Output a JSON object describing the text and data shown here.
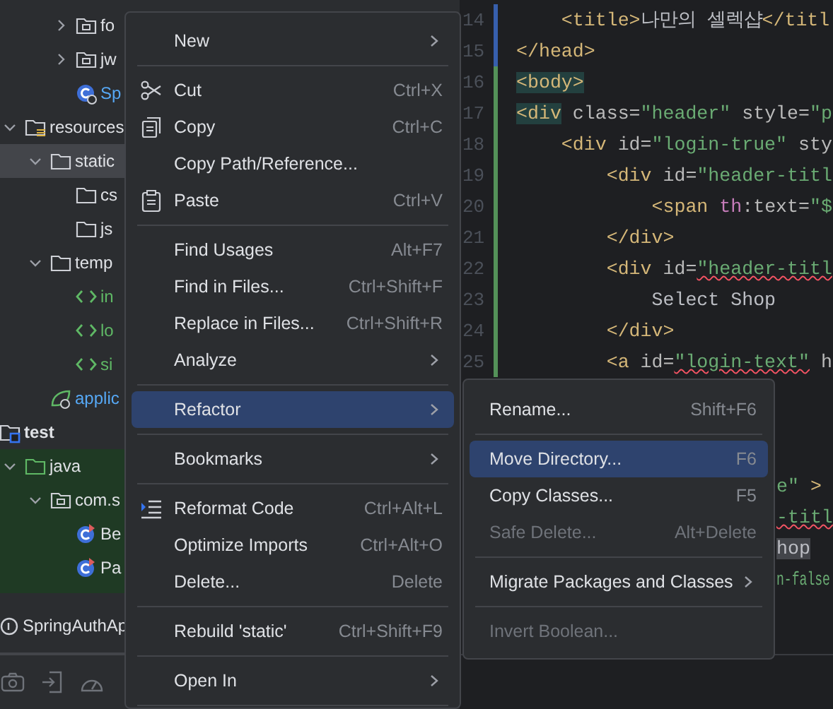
{
  "project_tree": [
    {
      "children": [
        {
          "children": [
            {
              "children": [
                {
                  "label": "fo",
                  "kind": "package",
                  "expanded": false,
                  "selected": false
                },
                {
                  "label": "jw",
                  "kind": "package",
                  "expanded": false,
                  "selected": false
                },
                {
                  "label": "Sp",
                  "kind": "spring-class",
                  "selected": false
                }
              ]
            }
          ]
        },
        {
          "label": "resources",
          "kind": "resource-folder",
          "expanded": true,
          "selected": false,
          "children": [
            {
              "label": "static",
              "kind": "folder",
              "expanded": true,
              "selected": true,
              "children": [
                {
                  "label": "cs",
                  "kind": "folder",
                  "selected": false
                },
                {
                  "label": "js",
                  "kind": "folder",
                  "selected": false
                }
              ]
            },
            {
              "label": "temp",
              "kind": "folder",
              "expanded": true,
              "selected": false,
              "children": [
                {
                  "label": "in",
                  "kind": "html",
                  "selected": false
                },
                {
                  "label": "lo",
                  "kind": "html",
                  "selected": false
                },
                {
                  "label": "si",
                  "kind": "html",
                  "selected": false
                }
              ]
            },
            {
              "label": "applic",
              "kind": "spring-config",
              "selected": false
            }
          ]
        }
      ]
    },
    {
      "label": "test",
      "kind": "test-folder",
      "selected": false,
      "children": [
        {
          "label": "java",
          "kind": "test-source",
          "expanded": true,
          "selected": false,
          "test_scope": true,
          "children": [
            {
              "label": "com.s",
              "kind": "package",
              "expanded": true,
              "selected": false,
              "test_scope": true,
              "children": [
                {
                  "label": "Be",
                  "kind": "test-class",
                  "selected": false,
                  "test_scope": true
                },
                {
                  "label": "Pa",
                  "kind": "test-class",
                  "selected": false,
                  "test_scope": true
                }
              ]
            }
          ]
        }
      ]
    }
  ],
  "run_config": {
    "label": "SpringAuthAp"
  },
  "toolbar": [
    {
      "kind": "camera"
    },
    {
      "kind": "enter"
    },
    {
      "kind": "gauge"
    }
  ],
  "editor": {
    "lines": [
      {
        "kind": "full",
        "number": "14",
        "modified": true,
        "segments": [
          {
            "kind": "tag",
            "text": "    <title>"
          },
          {
            "kind": "text",
            "text": "나만의 셀렉샵"
          },
          {
            "kind": "tag",
            "text": "</titl"
          }
        ]
      },
      {
        "kind": "full",
        "number": "15",
        "modified": true,
        "segments": [
          {
            "kind": "tag",
            "text": "</head>"
          }
        ]
      },
      {
        "kind": "full",
        "number": "16",
        "modified": false,
        "segments": [
          {
            "kind": "tag",
            "text": "<body>",
            "highlight": true
          }
        ]
      },
      {
        "kind": "full",
        "number": "17",
        "modified": false,
        "segments": [
          {
            "kind": "tag",
            "text": "<div",
            "highlight": true
          },
          {
            "kind": "attr",
            "text": " class="
          },
          {
            "kind": "string",
            "text": "\"header\""
          },
          {
            "kind": "attr",
            "text": " style="
          },
          {
            "kind": "string",
            "text": "\"p"
          }
        ]
      },
      {
        "kind": "full",
        "number": "18",
        "modified": false,
        "segments": [
          {
            "kind": "tag",
            "text": "    <div"
          },
          {
            "kind": "attr",
            "text": " id="
          },
          {
            "kind": "string",
            "text": "\"login-true\""
          },
          {
            "kind": "attr",
            "text": " sty"
          }
        ]
      },
      {
        "kind": "full",
        "number": "19",
        "modified": false,
        "segments": [
          {
            "kind": "tag",
            "text": "        <div"
          },
          {
            "kind": "attr",
            "text": " id="
          },
          {
            "kind": "string",
            "text": "\"header-titl"
          }
        ]
      },
      {
        "kind": "full",
        "number": "20",
        "modified": false,
        "segments": [
          {
            "kind": "tag",
            "text": "            <span"
          },
          {
            "kind": "ns",
            "text": " th"
          },
          {
            "kind": "attr",
            "text": ":text="
          },
          {
            "kind": "string",
            "text": "\"$"
          }
        ]
      },
      {
        "kind": "full",
        "number": "21",
        "modified": false,
        "segments": [
          {
            "kind": "tag",
            "text": "        </div>"
          }
        ]
      },
      {
        "kind": "full",
        "number": "22",
        "modified": false,
        "segments": [
          {
            "kind": "tag",
            "text": "        <div"
          },
          {
            "kind": "attr",
            "text": " id="
          },
          {
            "kind": "string",
            "text": "\"header-titl",
            "squiggle": true
          }
        ]
      },
      {
        "kind": "full",
        "number": "23",
        "modified": false,
        "segments": [
          {
            "kind": "text",
            "text": "            Select Shop"
          }
        ]
      },
      {
        "kind": "full",
        "number": "24",
        "modified": false,
        "segments": [
          {
            "kind": "tag",
            "text": "        </div>"
          }
        ]
      },
      {
        "kind": "full",
        "number": "25",
        "modified": false,
        "segments": [
          {
            "kind": "tag",
            "text": "        <a"
          },
          {
            "kind": "attr",
            "text": " id="
          },
          {
            "kind": "string",
            "text": "\"login-text\"",
            "squiggle": true
          },
          {
            "kind": "attr",
            "text": " h"
          }
        ]
      },
      {
        "kind": "blank"
      },
      {
        "kind": "blank"
      },
      {
        "kind": "blank"
      },
      {
        "kind": "tail",
        "segments": [
          {
            "kind": "string",
            "text": "e\""
          },
          {
            "kind": "tag",
            "text": " >"
          }
        ]
      },
      {
        "kind": "tail",
        "segments": [
          {
            "kind": "string",
            "text": "-titl",
            "squiggle": true
          }
        ]
      },
      {
        "kind": "tail",
        "segments": [
          {
            "kind": "text",
            "text": "hop",
            "highlight": true
          }
        ]
      },
      {
        "kind": "tail-condensed",
        "segments": [
          {
            "kind": "string",
            "text": "n-false"
          }
        ]
      }
    ]
  },
  "context_menu": {
    "items": [
      {
        "kind": "item",
        "label": "New",
        "submenu": true,
        "selected": false,
        "disabled": false
      },
      {
        "kind": "separator"
      },
      {
        "kind": "item",
        "label": "Cut",
        "shortcut": "Ctrl+X",
        "selected": false,
        "disabled": false
      },
      {
        "kind": "item",
        "label": "Copy",
        "shortcut": "Ctrl+C",
        "selected": false,
        "disabled": false
      },
      {
        "kind": "item",
        "label": "Copy Path/Reference...",
        "selected": false,
        "disabled": false
      },
      {
        "kind": "item",
        "label": "Paste",
        "shortcut": "Ctrl+V",
        "selected": false,
        "disabled": false
      },
      {
        "kind": "separator"
      },
      {
        "kind": "item",
        "label": "Find Usages",
        "shortcut": "Alt+F7",
        "selected": false,
        "disabled": false
      },
      {
        "kind": "item",
        "label": "Find in Files...",
        "shortcut": "Ctrl+Shift+F",
        "selected": false,
        "disabled": false
      },
      {
        "kind": "item",
        "label": "Replace in Files...",
        "shortcut": "Ctrl+Shift+R",
        "selected": false,
        "disabled": false
      },
      {
        "kind": "item",
        "label": "Analyze",
        "submenu": true,
        "selected": false,
        "disabled": false
      },
      {
        "kind": "separator"
      },
      {
        "kind": "item",
        "label": "Refactor",
        "submenu": true,
        "selected": true,
        "disabled": false
      },
      {
        "kind": "separator"
      },
      {
        "kind": "item",
        "label": "Bookmarks",
        "submenu": true,
        "selected": false,
        "disabled": false
      },
      {
        "kind": "separator"
      },
      {
        "kind": "item",
        "label": "Reformat Code",
        "shortcut": "Ctrl+Alt+L",
        "selected": false,
        "disabled": false
      },
      {
        "kind": "item",
        "label": "Optimize Imports",
        "shortcut": "Ctrl+Alt+O",
        "selected": false,
        "disabled": false
      },
      {
        "kind": "item",
        "label": "Delete...",
        "shortcut": "Delete",
        "selected": false,
        "disabled": false
      },
      {
        "kind": "separator"
      },
      {
        "kind": "item",
        "label": "Rebuild 'static'",
        "shortcut": "Ctrl+Shift+F9",
        "selected": false,
        "disabled": false
      },
      {
        "kind": "separator"
      },
      {
        "kind": "item",
        "label": "Open In",
        "submenu": true,
        "selected": false,
        "disabled": false
      },
      {
        "kind": "separator"
      }
    ]
  },
  "refactor_submenu": {
    "items": [
      {
        "kind": "item",
        "label": "Rename...",
        "shortcut": "Shift+F6",
        "selected": false,
        "disabled": false
      },
      {
        "kind": "separator"
      },
      {
        "kind": "item",
        "label": "Move Directory...",
        "shortcut": "F6",
        "selected": true,
        "disabled": false
      },
      {
        "kind": "item",
        "label": "Copy Classes...",
        "shortcut": "F5",
        "selected": false,
        "disabled": false
      },
      {
        "kind": "item",
        "label": "Safe Delete...",
        "shortcut": "Alt+Delete",
        "selected": false,
        "disabled": true
      },
      {
        "kind": "separator"
      },
      {
        "kind": "item",
        "label": "Migrate Packages and Classes",
        "submenu": true,
        "selected": false,
        "disabled": false
      },
      {
        "kind": "separator"
      },
      {
        "kind": "item",
        "label": "Invert Boolean...",
        "selected": false,
        "disabled": true
      }
    ]
  }
}
